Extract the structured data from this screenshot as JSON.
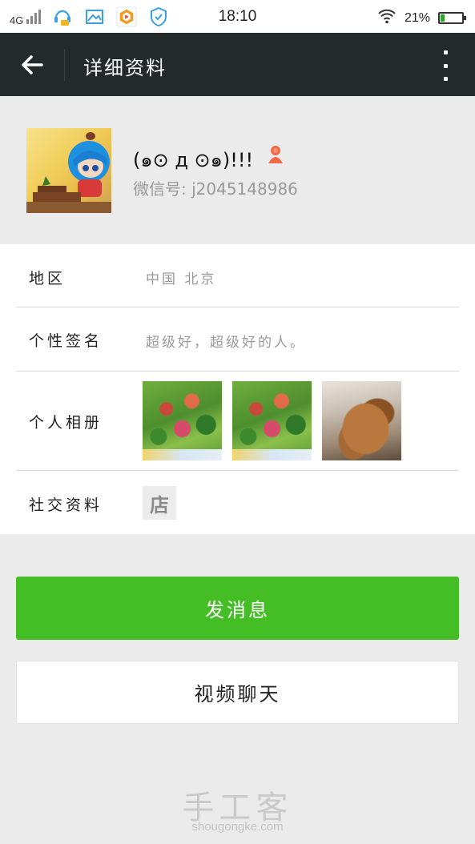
{
  "status_bar": {
    "network": "4G",
    "time": "18:10",
    "battery_percent": "21%",
    "battery_level": 0.21,
    "icons": [
      "signal-icon",
      "headset-app-icon",
      "gallery-icon",
      "app-store-icon",
      "shield-check-icon",
      "wifi-icon",
      "battery-icon"
    ]
  },
  "titlebar": {
    "title": "详细资料",
    "back_icon": "arrow-left-icon",
    "more_icon": "more-vertical-icon"
  },
  "profile": {
    "nickname": "(๑⊙ д ⊙๑)!!!",
    "wechat_id": "微信号: j2045148986",
    "gender_icon": "female-person-icon"
  },
  "info": {
    "region_label": "地区",
    "region_value": "中国  北京",
    "signature_label": "个性签名",
    "signature_value": "超级好，超级好的人。",
    "album_label": "个人相册",
    "social_label": "社交资料",
    "social_shop_glyph": "店"
  },
  "buttons": {
    "send_message": "发消息",
    "video_chat": "视频聊天"
  },
  "watermark": {
    "brand": "手工客",
    "site": "shougongke.com"
  },
  "colors": {
    "titlebar": "#24292b",
    "primary_button": "#45bd25",
    "background": "#ebebeb"
  }
}
